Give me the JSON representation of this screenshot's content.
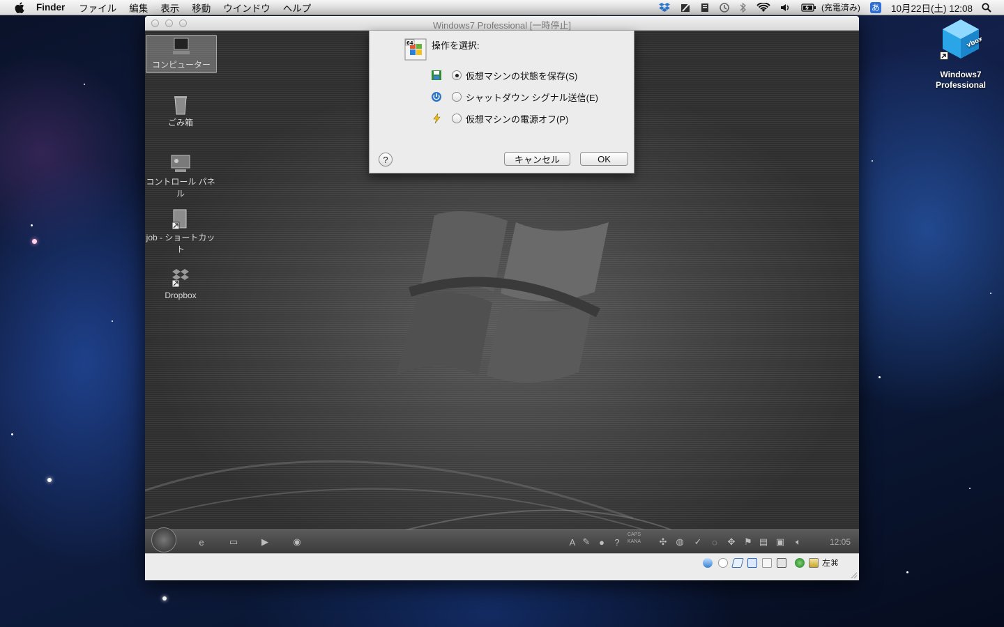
{
  "menubar": {
    "app_name": "Finder",
    "items": [
      "ファイル",
      "編集",
      "表示",
      "移動",
      "ウインドウ",
      "ヘルプ"
    ],
    "battery_text": "(充電済み)",
    "ime_label": "あ",
    "datetime": "10月22日(土) 12:08"
  },
  "window": {
    "title": "Windows7 Professional [一時停止]"
  },
  "guest_desktop": {
    "icons": [
      {
        "label": "コンピューター"
      },
      {
        "label": "ごみ箱"
      },
      {
        "label": "コントロール パネル"
      },
      {
        "label": "job - ショートカット"
      },
      {
        "label": "Dropbox"
      }
    ],
    "taskbar_time": "12:05",
    "caps_label": "CAPS",
    "kana_label": "KANA"
  },
  "dialog": {
    "heading": "操作を選択:",
    "options": [
      {
        "label": "仮想マシンの状態を保存(S)",
        "selected": true
      },
      {
        "label": "シャットダウン シグナル送信(E)",
        "selected": false
      },
      {
        "label": "仮想マシンの電源オフ(P)",
        "selected": false
      }
    ],
    "help_label": "?",
    "cancel_label": "キャンセル",
    "ok_label": "OK",
    "vm_icon_badge": "64"
  },
  "statusbar": {
    "host_key": "左⌘"
  },
  "mac_desktop": {
    "icon_label": "Windows7 Professional",
    "icon_text": "vbox"
  },
  "colors": {
    "menubar": "#e6e6e6",
    "dialog_bg": "#ececec",
    "ime_blue": "#2f6fd6"
  }
}
